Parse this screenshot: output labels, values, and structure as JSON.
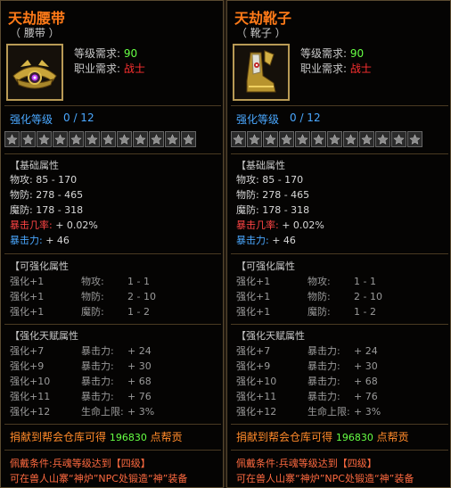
{
  "colors": {
    "title": "#ff7a18",
    "req_value": "#66ff44",
    "req_class": "#ff3030",
    "enh": "#4aa8ff",
    "crit_rate": "#ff4444",
    "crit_dmg": "#4aa8ff",
    "donate": "#ff8a2a",
    "donate_num": "#66ff44",
    "condition": "#ff6a40"
  },
  "left": {
    "title": "天劫腰带",
    "subtype": "（ 腰带 ）",
    "icon": "belt-icon",
    "level_req_label": "等级需求:",
    "level_req_value": "90",
    "class_req_label": "职业需求:",
    "class_req_value": "战士",
    "enh_label": "强化等级",
    "enh_value": "0 / 12",
    "star_count": 12,
    "basic_title": "【基础属性",
    "basic": [
      {
        "label": "物攻:",
        "value": "85 - 170"
      },
      {
        "label": "物防:",
        "value": "278 - 465"
      },
      {
        "label": "魔防:",
        "value": "178 - 318"
      },
      {
        "label": "暴击几率:",
        "value": "+ 0.02%"
      },
      {
        "label": "暴击力:",
        "value": "+ 46"
      }
    ],
    "enhanceable_title": "【可强化属性",
    "enhanceable": [
      {
        "lvl": "强化+1",
        "label": "物攻:",
        "value": "1 - 1"
      },
      {
        "lvl": "强化+1",
        "label": "物防:",
        "value": "2 - 10"
      },
      {
        "lvl": "强化+1",
        "label": "魔防:",
        "value": "1 - 2"
      }
    ],
    "talent_title": "【强化天赋属性",
    "talent": [
      {
        "lvl": "强化+7",
        "label": "暴击力:",
        "value": "+ 24"
      },
      {
        "lvl": "强化+9",
        "label": "暴击力:",
        "value": "+ 30"
      },
      {
        "lvl": "强化+10",
        "label": "暴击力:",
        "value": "+ 68"
      },
      {
        "lvl": "强化+11",
        "label": "暴击力:",
        "value": "+ 76"
      },
      {
        "lvl": "强化+12",
        "label": "生命上限:",
        "value": "+ 3%"
      }
    ],
    "donate_label": "捐献到帮会仓库可得",
    "donate_value": "196830",
    "donate_suffix": "点帮贡",
    "cond1": "佩戴条件:兵魂等级达到【四级】",
    "cond2": "可在兽人山寨“神炉”NPC处锻造“神”装备"
  },
  "right": {
    "title": "天劫靴子",
    "subtype": "（ 靴子 ）",
    "icon": "boots-icon",
    "level_req_label": "等级需求:",
    "level_req_value": "90",
    "class_req_label": "职业需求:",
    "class_req_value": "战士",
    "enh_label": "强化等级",
    "enh_value": "0 / 12",
    "star_count": 12,
    "basic_title": "【基础属性",
    "basic": [
      {
        "label": "物攻:",
        "value": "85 - 170"
      },
      {
        "label": "物防:",
        "value": "278 - 465"
      },
      {
        "label": "魔防:",
        "value": "178 - 318"
      },
      {
        "label": "暴击几率:",
        "value": "+ 0.02%"
      },
      {
        "label": "暴击力:",
        "value": "+ 46"
      }
    ],
    "enhanceable_title": "【可强化属性",
    "enhanceable": [
      {
        "lvl": "强化+1",
        "label": "物攻:",
        "value": "1 - 1"
      },
      {
        "lvl": "强化+1",
        "label": "物防:",
        "value": "2 - 10"
      },
      {
        "lvl": "强化+1",
        "label": "魔防:",
        "value": "1 - 2"
      }
    ],
    "talent_title": "【强化天赋属性",
    "talent": [
      {
        "lvl": "强化+7",
        "label": "暴击力:",
        "value": "+ 24"
      },
      {
        "lvl": "强化+9",
        "label": "暴击力:",
        "value": "+ 30"
      },
      {
        "lvl": "强化+10",
        "label": "暴击力:",
        "value": "+ 68"
      },
      {
        "lvl": "强化+11",
        "label": "暴击力:",
        "value": "+ 76"
      },
      {
        "lvl": "强化+12",
        "label": "生命上限:",
        "value": "+ 3%"
      }
    ],
    "donate_label": "捐献到帮会仓库可得",
    "donate_value": "196830",
    "donate_suffix": "点帮贡",
    "cond1": "佩戴条件:兵魂等级达到【四级】",
    "cond2": "可在兽人山寨“神炉”NPC处锻造“神”装备"
  }
}
